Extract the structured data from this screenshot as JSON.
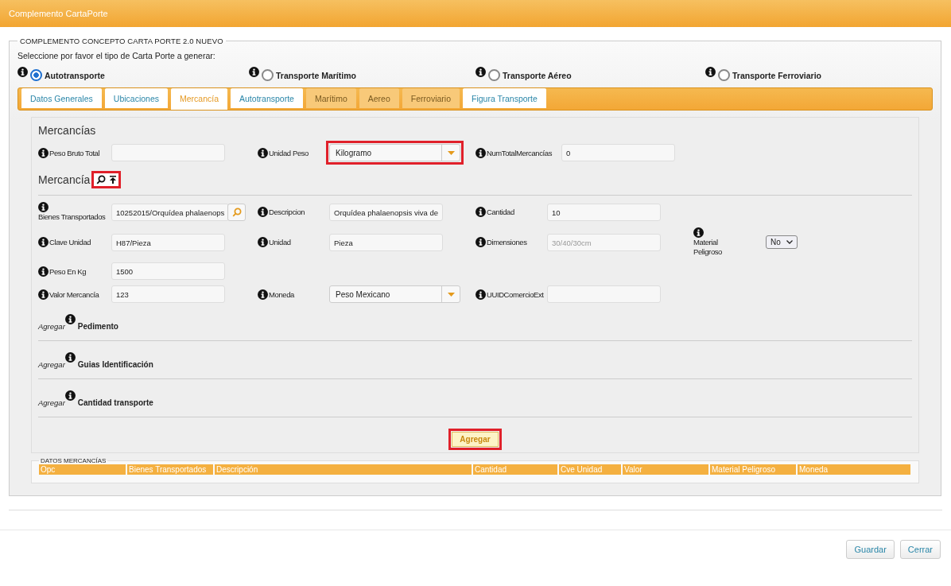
{
  "window": {
    "title": "Complemento CartaPorte"
  },
  "section": {
    "legend": "COMPLEMENTO CONCEPTO CARTA PORTE 2.0 NUEVO",
    "prompt": "Seleccione por favor el tipo de Carta Porte a generar:",
    "transport_types": [
      {
        "label": "Autotransporte",
        "selected": true
      },
      {
        "label": "Transporte Marítimo",
        "selected": false
      },
      {
        "label": "Transporte Aéreo",
        "selected": false
      },
      {
        "label": "Transporte Ferroviario",
        "selected": false
      }
    ]
  },
  "tabs": [
    {
      "label": "Datos Generales",
      "selected": false,
      "disabled": false
    },
    {
      "label": "Ubicaciones",
      "selected": false,
      "disabled": false
    },
    {
      "label": "Mercancía",
      "selected": true,
      "disabled": false
    },
    {
      "label": "Autotransporte",
      "selected": false,
      "disabled": false
    },
    {
      "label": "Marítimo",
      "selected": false,
      "disabled": true
    },
    {
      "label": "Aereo",
      "selected": false,
      "disabled": true
    },
    {
      "label": "Ferroviario",
      "selected": false,
      "disabled": true
    },
    {
      "label": "Figura Transporte",
      "selected": false,
      "disabled": false
    }
  ],
  "mercancias": {
    "title": "Mercancías",
    "fields": [
      {
        "kind": "text",
        "label": "Peso Bruto Total"
      },
      {
        "kind": "combo",
        "label": "Unidad Peso",
        "value": "Kilogramo",
        "highlighted": true
      },
      {
        "kind": "text",
        "label": "NumTotalMercancías",
        "value": "0"
      }
    ]
  },
  "mercancia": {
    "title": "Mercancía",
    "tools_highlighted": true,
    "rows": [
      [
        {
          "kind": "search",
          "label": "Bienes Transportados",
          "value": "10252015/Orquídea phalaenops"
        },
        {
          "kind": "text",
          "label": "Descripcion",
          "value": "Orquídea phalaenopsis viva de"
        },
        {
          "kind": "text",
          "label": "Cantidad",
          "value": "10"
        }
      ],
      [
        {
          "kind": "text",
          "label": "Clave Unidad",
          "value": "H87/Pieza"
        },
        {
          "kind": "text",
          "label": "Unidad",
          "value": "Pieza"
        },
        {
          "kind": "text",
          "label": "Dimensiones",
          "value": "30/40/30cm",
          "disabled": true
        },
        {
          "kind": "small-select",
          "label": "Material Peligroso",
          "value": "No"
        }
      ],
      [
        {
          "kind": "text",
          "label": "Peso En Kg",
          "value": "1500"
        }
      ],
      [
        {
          "kind": "text",
          "label": "Valor Mercancía",
          "value": "123"
        },
        {
          "kind": "combo",
          "label": "Moneda",
          "value": "Peso Mexicano"
        },
        {
          "kind": "text",
          "label": "UUIDComercioExt"
        }
      ]
    ],
    "add_sections": [
      {
        "prefix": "Agregar",
        "label": "Pedimento"
      },
      {
        "prefix": "Agregar",
        "label": "Guias Identificación"
      },
      {
        "prefix": "Agregar",
        "label": "Cantidad transporte"
      }
    ],
    "add_button": {
      "label": "Agregar",
      "highlighted": true
    }
  },
  "table": {
    "legend": "DATOS MERCANCÍAS",
    "columns": [
      "Opc",
      "Bienes Transportados",
      "Descripción",
      "Cantidad",
      "Cve Unidad",
      "Valor",
      "Material Peligroso",
      "Moneda"
    ]
  },
  "buttons": [
    "Guardar",
    "Cerrar"
  ]
}
